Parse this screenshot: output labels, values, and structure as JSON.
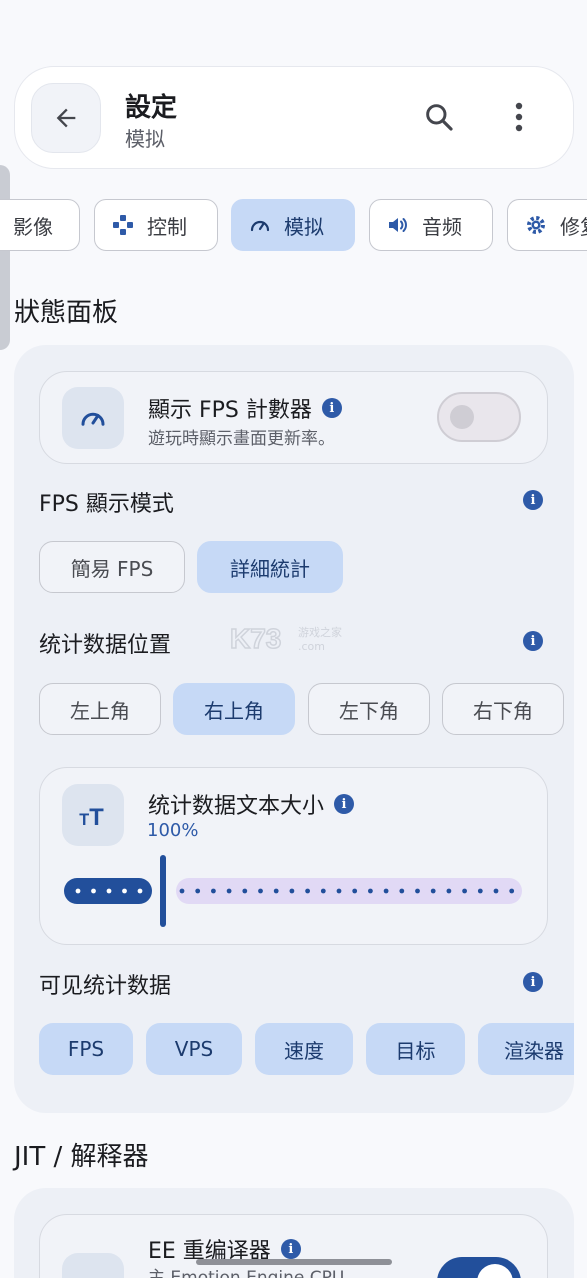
{
  "header": {
    "title": "設定",
    "subtitle": "模拟"
  },
  "tabs": [
    {
      "label": "影像",
      "icon": "image-icon"
    },
    {
      "label": "控制",
      "icon": "gamepad-icon",
      "selected": false
    },
    {
      "label": "模拟",
      "icon": "speedometer-icon",
      "selected": true
    },
    {
      "label": "音频",
      "icon": "speaker-icon",
      "selected": false
    },
    {
      "label": "修复",
      "icon": "gear-icon",
      "selected": false
    }
  ],
  "sections": {
    "status_panel": "狀態面板",
    "jit": "JIT / 解释器"
  },
  "fps_counter": {
    "title": "顯示 FPS 計數器",
    "description": "遊玩時顯示畫面更新率。",
    "enabled": false
  },
  "fps_mode": {
    "label": "FPS 顯示模式",
    "options": [
      "簡易 FPS",
      "詳細統計"
    ],
    "selected": "詳細統計"
  },
  "stats_position": {
    "label": "统计数据位置",
    "options": [
      "左上角",
      "右上角",
      "左下角",
      "右下角"
    ],
    "selected": "右上角"
  },
  "stats_text_size": {
    "title": "统计数据文本大小",
    "value_text": "100%",
    "value_fraction": 0.2
  },
  "visible_stats": {
    "label": "可见统计数据",
    "items": [
      "FPS",
      "VPS",
      "速度",
      "目标",
      "渲染器"
    ]
  },
  "ee_recompiler": {
    "title": "EE 重编译器",
    "description": "主 Emotion Engine CPU",
    "enabled": true
  },
  "colors": {
    "accent": "#224f9b",
    "selected_chip": "#c6d9f6",
    "panel": "#edf0f6"
  }
}
